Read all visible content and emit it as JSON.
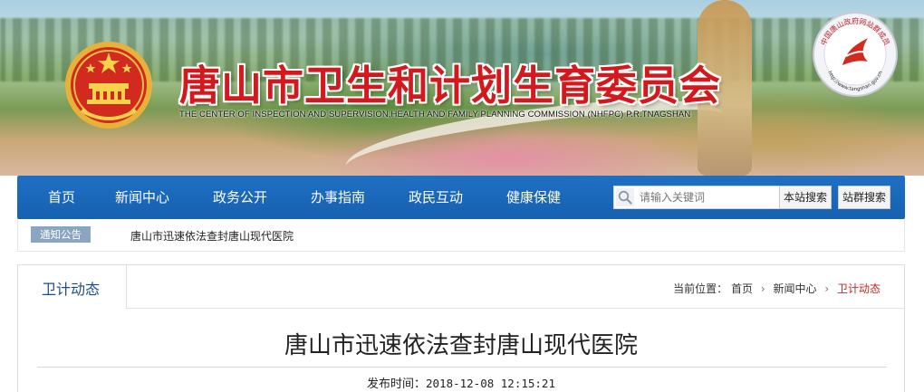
{
  "header": {
    "title": "唐山市卫生和计划生育委员会",
    "subtitle": "THE CENTER OF INSPECTION AND SUPERVISION,HEALTH AND FAMILY PLANNING COMMISSION (NHFPC) P.R.TNAGSHAN",
    "seal": {
      "text": "中国唐山政府网站群成员",
      "url": "http://www.tangshan.gov.cn"
    }
  },
  "nav": {
    "items": [
      "首页",
      "新闻中心",
      "政务公开",
      "办事指南",
      "政民互动",
      "健康保健"
    ],
    "search_placeholder": "请输入关键词",
    "search_site_button": "本站搜索",
    "search_group_button": "站群搜索"
  },
  "notice": {
    "label": "通知公告",
    "text": "唐山市迅速依法查封唐山现代医院"
  },
  "panel": {
    "tab": "卫计动态",
    "breadcrumb": {
      "prefix": "当前位置：",
      "items": [
        "首页",
        "新闻中心",
        "卫计动态"
      ],
      "separator": "›"
    },
    "article_title": "唐山市迅速依法查封唐山现代医院",
    "publish_label": "发布时间：",
    "publish_time": "2018-12-08 12:15:21"
  },
  "colors": {
    "brand_blue": "#1e6fc3",
    "title_red": "#d3191d",
    "crumb_current": "#c4281e"
  },
  "icons": {
    "emblem": "national-emblem-icon",
    "seal": "government-website-seal-icon",
    "search": "search-icon"
  }
}
